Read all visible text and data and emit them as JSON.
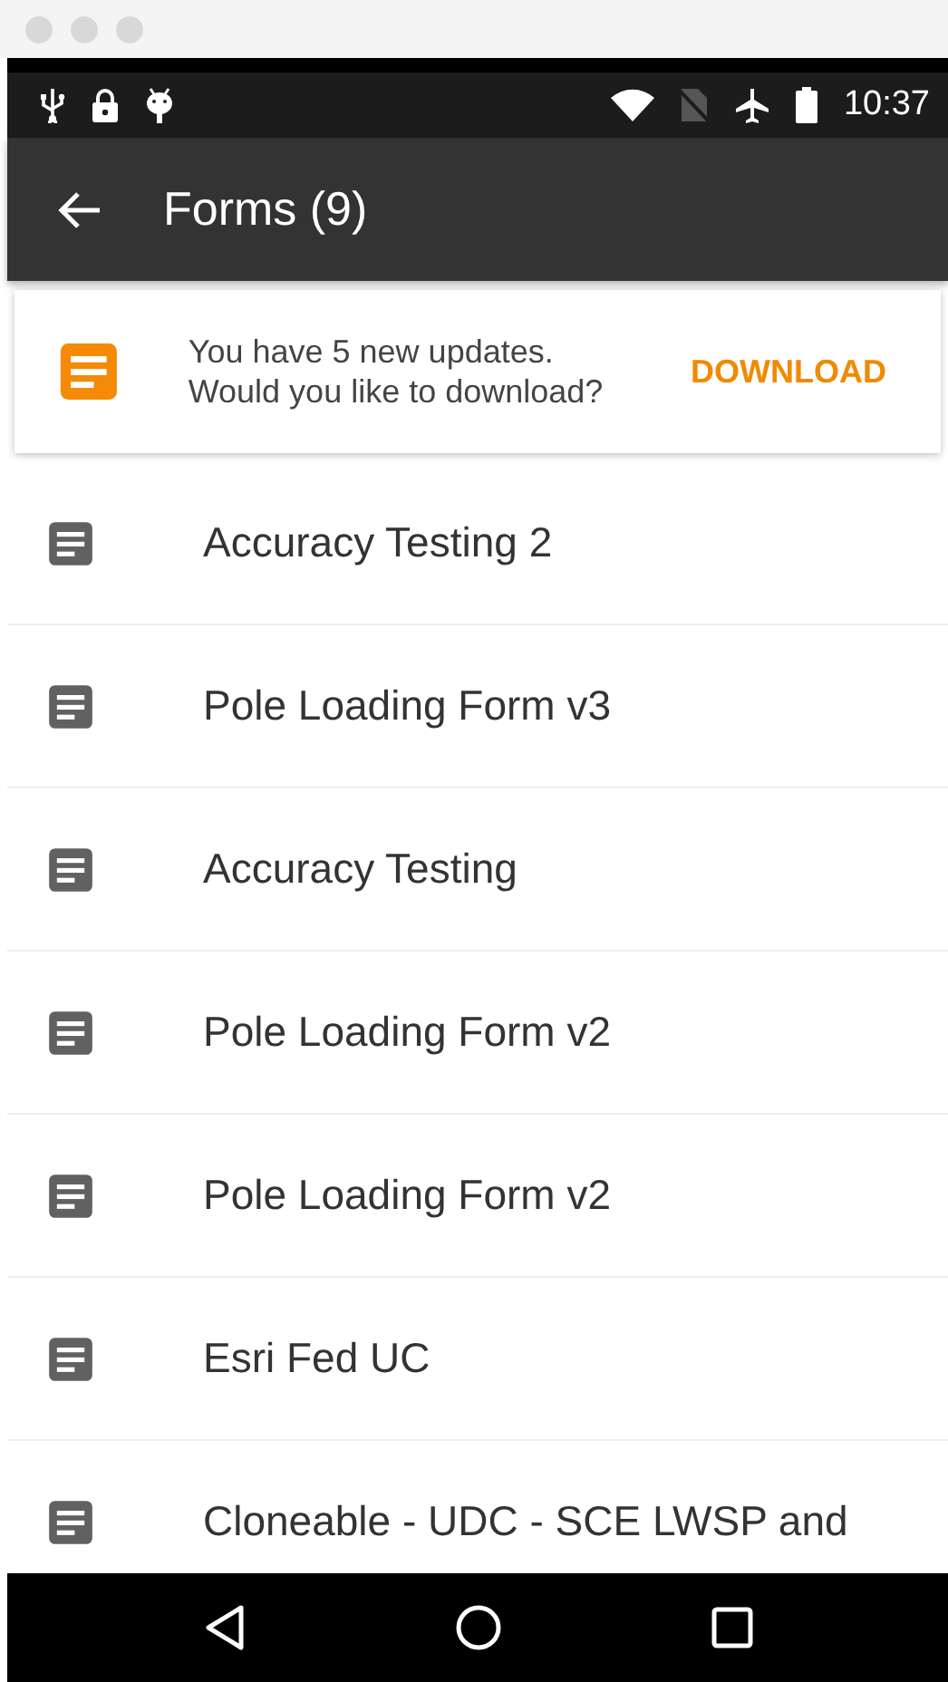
{
  "status_bar": {
    "time": "10:37"
  },
  "app_bar": {
    "title": "Forms (9)"
  },
  "banner": {
    "message": "You have 5 new updates. Would you like to download?",
    "action": "DOWNLOAD"
  },
  "forms": [
    {
      "name": "Accuracy Testing 2"
    },
    {
      "name": "Pole Loading Form v3"
    },
    {
      "name": "Accuracy Testing"
    },
    {
      "name": "Pole Loading Form v2"
    },
    {
      "name": "Pole Loading Form v2"
    },
    {
      "name": "Esri Fed UC"
    },
    {
      "name": "Cloneable - UDC - SCE LWSP and"
    }
  ]
}
